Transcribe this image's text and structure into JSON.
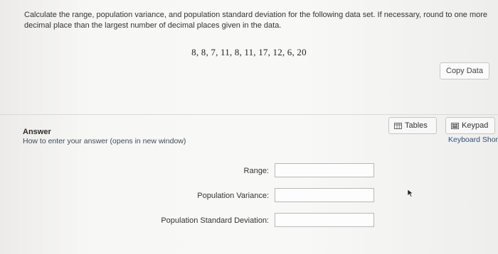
{
  "question": {
    "prompt": "Calculate the range, population variance, and population standard deviation for the following data set. If necessary, round to one more decimal place than the largest number of decimal places given in the data.",
    "data_set": "8, 8, 7, 11, 8, 11, 17, 12, 6, 20"
  },
  "toolbar": {
    "copy_label": "Copy Data",
    "tables_label": "Tables",
    "keypad_label": "Keypad",
    "shortcuts_label": "Keyboard Shortcuts"
  },
  "answer": {
    "heading": "Answer",
    "help_link": "How to enter your answer (opens in new window)",
    "fields": {
      "range_label": "Range:",
      "range_value": "",
      "variance_label": "Population Variance:",
      "variance_value": "",
      "sd_label": "Population Standard Deviation:",
      "sd_value": ""
    }
  },
  "icons": {
    "tables": "table-grid-icon",
    "keypad": "keypad-icon",
    "cursor": "mouse-pointer-icon"
  }
}
